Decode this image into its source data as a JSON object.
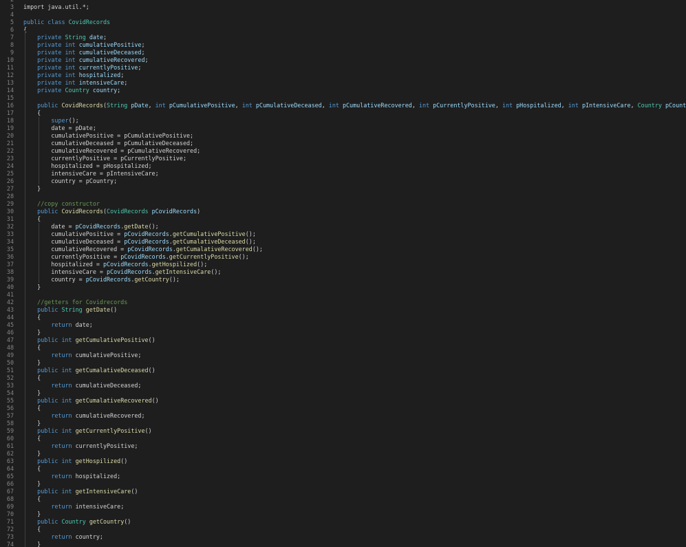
{
  "editor": {
    "language": "java",
    "theme_colors": {
      "background": "#1e1e1e",
      "line_number": "#858585",
      "keyword": "#569cd6",
      "type": "#4ec9b0",
      "function": "#dcdcaa",
      "variable": "#9cdcfe",
      "plain": "#d4d4d4",
      "comment": "#6a9955"
    },
    "lines": [
      {
        "n": "2",
        "tokens": []
      },
      {
        "n": "3",
        "tokens": [
          {
            "t": "import java.util.*;",
            "c": "plain"
          }
        ]
      },
      {
        "n": "4",
        "tokens": []
      },
      {
        "n": "5",
        "tokens": [
          {
            "t": "public class ",
            "c": "kw"
          },
          {
            "t": "CovidRecords",
            "c": "type"
          }
        ]
      },
      {
        "n": "6",
        "tokens": [
          {
            "t": "{",
            "c": "plain"
          }
        ]
      },
      {
        "n": "7",
        "tokens": [
          {
            "t": "    private ",
            "c": "kw"
          },
          {
            "t": "String ",
            "c": "type"
          },
          {
            "t": "date",
            "c": "var"
          },
          {
            "t": ";",
            "c": "plain"
          }
        ]
      },
      {
        "n": "8",
        "tokens": [
          {
            "t": "    private int ",
            "c": "kw"
          },
          {
            "t": "cumulativePositive",
            "c": "var"
          },
          {
            "t": ";",
            "c": "plain"
          }
        ]
      },
      {
        "n": "9",
        "tokens": [
          {
            "t": "    private int ",
            "c": "kw"
          },
          {
            "t": "cumulativeDeceased",
            "c": "var"
          },
          {
            "t": ";",
            "c": "plain"
          }
        ]
      },
      {
        "n": "10",
        "tokens": [
          {
            "t": "    private int ",
            "c": "kw"
          },
          {
            "t": "cumulativeRecovered",
            "c": "var"
          },
          {
            "t": ";",
            "c": "plain"
          }
        ]
      },
      {
        "n": "11",
        "tokens": [
          {
            "t": "    private int ",
            "c": "kw"
          },
          {
            "t": "currentlyPositive",
            "c": "var"
          },
          {
            "t": ";",
            "c": "plain"
          }
        ]
      },
      {
        "n": "12",
        "tokens": [
          {
            "t": "    private int ",
            "c": "kw"
          },
          {
            "t": "hospitalized",
            "c": "var"
          },
          {
            "t": ";",
            "c": "plain"
          }
        ]
      },
      {
        "n": "13",
        "tokens": [
          {
            "t": "    private int ",
            "c": "kw"
          },
          {
            "t": "intensiveCare",
            "c": "var"
          },
          {
            "t": ";",
            "c": "plain"
          }
        ]
      },
      {
        "n": "14",
        "tokens": [
          {
            "t": "    private ",
            "c": "kw"
          },
          {
            "t": "Country ",
            "c": "type"
          },
          {
            "t": "country",
            "c": "var"
          },
          {
            "t": ";",
            "c": "plain"
          }
        ]
      },
      {
        "n": "15",
        "tokens": []
      },
      {
        "n": "16",
        "tokens": [
          {
            "t": "    public ",
            "c": "kw"
          },
          {
            "t": "CovidRecords",
            "c": "fn"
          },
          {
            "t": "(",
            "c": "plain"
          },
          {
            "t": "String ",
            "c": "type"
          },
          {
            "t": "pDate",
            "c": "var"
          },
          {
            "t": ", ",
            "c": "plain"
          },
          {
            "t": "int ",
            "c": "kw"
          },
          {
            "t": "pCumulativePositive",
            "c": "var"
          },
          {
            "t": ", ",
            "c": "plain"
          },
          {
            "t": "int ",
            "c": "kw"
          },
          {
            "t": "pCumulativeDeceased",
            "c": "var"
          },
          {
            "t": ", ",
            "c": "plain"
          },
          {
            "t": "int ",
            "c": "kw"
          },
          {
            "t": "pCumulativeRecovered",
            "c": "var"
          },
          {
            "t": ", ",
            "c": "plain"
          },
          {
            "t": "int ",
            "c": "kw"
          },
          {
            "t": "pCurrentlyPositive",
            "c": "var"
          },
          {
            "t": ", ",
            "c": "plain"
          },
          {
            "t": "int ",
            "c": "kw"
          },
          {
            "t": "pHospitalized",
            "c": "var"
          },
          {
            "t": ", ",
            "c": "plain"
          },
          {
            "t": "int ",
            "c": "kw"
          },
          {
            "t": "pIntensiveCare",
            "c": "var"
          },
          {
            "t": ", ",
            "c": "plain"
          },
          {
            "t": "Country ",
            "c": "type"
          },
          {
            "t": "pCountry",
            "c": "var"
          },
          {
            "t": ")",
            "c": "plain"
          }
        ]
      },
      {
        "n": "17",
        "tokens": [
          {
            "t": "    {",
            "c": "plain"
          }
        ]
      },
      {
        "n": "18",
        "tokens": [
          {
            "t": "        super",
            "c": "kw"
          },
          {
            "t": "();",
            "c": "plain"
          }
        ]
      },
      {
        "n": "19",
        "tokens": [
          {
            "t": "        date = pDate;",
            "c": "plain"
          }
        ]
      },
      {
        "n": "20",
        "tokens": [
          {
            "t": "        cumulativePositive = pCumulativePositive;",
            "c": "plain"
          }
        ]
      },
      {
        "n": "21",
        "tokens": [
          {
            "t": "        cumulativeDeceased = pCumulativeDeceased;",
            "c": "plain"
          }
        ]
      },
      {
        "n": "22",
        "tokens": [
          {
            "t": "        cumulativeRecovered = pCumulativeRecovered;",
            "c": "plain"
          }
        ]
      },
      {
        "n": "23",
        "tokens": [
          {
            "t": "        currentlyPositive = pCurrentlyPositive;",
            "c": "plain"
          }
        ]
      },
      {
        "n": "24",
        "tokens": [
          {
            "t": "        hospitalized = pHospitalized;",
            "c": "plain"
          }
        ]
      },
      {
        "n": "25",
        "tokens": [
          {
            "t": "        intensiveCare = pIntensiveCare;",
            "c": "plain"
          }
        ]
      },
      {
        "n": "26",
        "tokens": [
          {
            "t": "        country = pCountry;",
            "c": "plain"
          }
        ]
      },
      {
        "n": "27",
        "tokens": [
          {
            "t": "    }",
            "c": "plain"
          }
        ]
      },
      {
        "n": "28",
        "tokens": []
      },
      {
        "n": "29",
        "tokens": [
          {
            "t": "    //copy constructor",
            "c": "comment"
          }
        ]
      },
      {
        "n": "30",
        "tokens": [
          {
            "t": "    public ",
            "c": "kw"
          },
          {
            "t": "CovidRecords",
            "c": "fn"
          },
          {
            "t": "(",
            "c": "plain"
          },
          {
            "t": "CovidRecords ",
            "c": "type"
          },
          {
            "t": "pCovidRecords",
            "c": "var"
          },
          {
            "t": ")",
            "c": "plain"
          }
        ]
      },
      {
        "n": "31",
        "tokens": [
          {
            "t": "    {",
            "c": "plain"
          }
        ]
      },
      {
        "n": "32",
        "tokens": [
          {
            "t": "        date = ",
            "c": "plain"
          },
          {
            "t": "pCovidRecords",
            "c": "var"
          },
          {
            "t": ".",
            "c": "plain"
          },
          {
            "t": "getDate",
            "c": "fn"
          },
          {
            "t": "();",
            "c": "plain"
          }
        ]
      },
      {
        "n": "33",
        "tokens": [
          {
            "t": "        cumulativePositive = ",
            "c": "plain"
          },
          {
            "t": "pCovidRecords",
            "c": "var"
          },
          {
            "t": ".",
            "c": "plain"
          },
          {
            "t": "getCumulativePositive",
            "c": "fn"
          },
          {
            "t": "();",
            "c": "plain"
          }
        ]
      },
      {
        "n": "34",
        "tokens": [
          {
            "t": "        cumulativeDeceased = ",
            "c": "plain"
          },
          {
            "t": "pCovidRecords",
            "c": "var"
          },
          {
            "t": ".",
            "c": "plain"
          },
          {
            "t": "getCumalativeDeceased",
            "c": "fn"
          },
          {
            "t": "();",
            "c": "plain"
          }
        ]
      },
      {
        "n": "35",
        "tokens": [
          {
            "t": "        cumulativeRecovered = ",
            "c": "plain"
          },
          {
            "t": "pCovidRecords",
            "c": "var"
          },
          {
            "t": ".",
            "c": "plain"
          },
          {
            "t": "getCumalativeRecovered",
            "c": "fn"
          },
          {
            "t": "();",
            "c": "plain"
          }
        ]
      },
      {
        "n": "36",
        "tokens": [
          {
            "t": "        currentlyPositive = ",
            "c": "plain"
          },
          {
            "t": "pCovidRecords",
            "c": "var"
          },
          {
            "t": ".",
            "c": "plain"
          },
          {
            "t": "getCurrentlyPositive",
            "c": "fn"
          },
          {
            "t": "();",
            "c": "plain"
          }
        ]
      },
      {
        "n": "37",
        "tokens": [
          {
            "t": "        hospitalized = ",
            "c": "plain"
          },
          {
            "t": "pCovidRecords",
            "c": "var"
          },
          {
            "t": ".",
            "c": "plain"
          },
          {
            "t": "getHospilized",
            "c": "fn"
          },
          {
            "t": "();",
            "c": "plain"
          }
        ]
      },
      {
        "n": "38",
        "tokens": [
          {
            "t": "        intensiveCare = ",
            "c": "plain"
          },
          {
            "t": "pCovidRecords",
            "c": "var"
          },
          {
            "t": ".",
            "c": "plain"
          },
          {
            "t": "getIntensiveCare",
            "c": "fn"
          },
          {
            "t": "();",
            "c": "plain"
          }
        ]
      },
      {
        "n": "39",
        "tokens": [
          {
            "t": "        country = ",
            "c": "plain"
          },
          {
            "t": "pCovidRecords",
            "c": "var"
          },
          {
            "t": ".",
            "c": "plain"
          },
          {
            "t": "getCountry",
            "c": "fn"
          },
          {
            "t": "();",
            "c": "plain"
          }
        ]
      },
      {
        "n": "40",
        "tokens": [
          {
            "t": "    }",
            "c": "plain"
          }
        ]
      },
      {
        "n": "41",
        "tokens": []
      },
      {
        "n": "42",
        "tokens": [
          {
            "t": "    //getters for Covidrecords",
            "c": "comment"
          }
        ]
      },
      {
        "n": "43",
        "tokens": [
          {
            "t": "    public ",
            "c": "kw"
          },
          {
            "t": "String ",
            "c": "type"
          },
          {
            "t": "getDate",
            "c": "fn"
          },
          {
            "t": "()",
            "c": "plain"
          }
        ]
      },
      {
        "n": "44",
        "tokens": [
          {
            "t": "    {",
            "c": "plain"
          }
        ]
      },
      {
        "n": "45",
        "tokens": [
          {
            "t": "        return ",
            "c": "kw"
          },
          {
            "t": "date;",
            "c": "plain"
          }
        ]
      },
      {
        "n": "46",
        "tokens": [
          {
            "t": "    }",
            "c": "plain"
          }
        ]
      },
      {
        "n": "47",
        "tokens": [
          {
            "t": "    public int ",
            "c": "kw"
          },
          {
            "t": "getCumulativePositive",
            "c": "fn"
          },
          {
            "t": "()",
            "c": "plain"
          }
        ]
      },
      {
        "n": "48",
        "tokens": [
          {
            "t": "    {",
            "c": "plain"
          }
        ]
      },
      {
        "n": "49",
        "tokens": [
          {
            "t": "        return ",
            "c": "kw"
          },
          {
            "t": "cumulativePositive;",
            "c": "plain"
          }
        ]
      },
      {
        "n": "50",
        "tokens": [
          {
            "t": "    }",
            "c": "plain"
          }
        ]
      },
      {
        "n": "51",
        "tokens": [
          {
            "t": "    public int ",
            "c": "kw"
          },
          {
            "t": "getCumalativeDeceased",
            "c": "fn"
          },
          {
            "t": "()",
            "c": "plain"
          }
        ]
      },
      {
        "n": "52",
        "tokens": [
          {
            "t": "    {",
            "c": "plain"
          }
        ]
      },
      {
        "n": "53",
        "tokens": [
          {
            "t": "        return ",
            "c": "kw"
          },
          {
            "t": "cumulativeDeceased;",
            "c": "plain"
          }
        ]
      },
      {
        "n": "54",
        "tokens": [
          {
            "t": "    }",
            "c": "plain"
          }
        ]
      },
      {
        "n": "55",
        "tokens": [
          {
            "t": "    public int ",
            "c": "kw"
          },
          {
            "t": "getCumalativeRecovered",
            "c": "fn"
          },
          {
            "t": "()",
            "c": "plain"
          }
        ]
      },
      {
        "n": "56",
        "tokens": [
          {
            "t": "    {",
            "c": "plain"
          }
        ]
      },
      {
        "n": "57",
        "tokens": [
          {
            "t": "        return ",
            "c": "kw"
          },
          {
            "t": "cumulativeRecovered;",
            "c": "plain"
          }
        ]
      },
      {
        "n": "58",
        "tokens": [
          {
            "t": "    }",
            "c": "plain"
          }
        ]
      },
      {
        "n": "59",
        "tokens": [
          {
            "t": "    public int ",
            "c": "kw"
          },
          {
            "t": "getCurrentlyPositive",
            "c": "fn"
          },
          {
            "t": "()",
            "c": "plain"
          }
        ]
      },
      {
        "n": "60",
        "tokens": [
          {
            "t": "    {",
            "c": "plain"
          }
        ]
      },
      {
        "n": "61",
        "tokens": [
          {
            "t": "        return ",
            "c": "kw"
          },
          {
            "t": "currentlyPositive;",
            "c": "plain"
          }
        ]
      },
      {
        "n": "62",
        "tokens": [
          {
            "t": "    }",
            "c": "plain"
          }
        ]
      },
      {
        "n": "63",
        "tokens": [
          {
            "t": "    public int ",
            "c": "kw"
          },
          {
            "t": "getHospilized",
            "c": "fn"
          },
          {
            "t": "()",
            "c": "plain"
          }
        ]
      },
      {
        "n": "64",
        "tokens": [
          {
            "t": "    {",
            "c": "plain"
          }
        ]
      },
      {
        "n": "65",
        "tokens": [
          {
            "t": "        return ",
            "c": "kw"
          },
          {
            "t": "hospitalized;",
            "c": "plain"
          }
        ]
      },
      {
        "n": "66",
        "tokens": [
          {
            "t": "    }",
            "c": "plain"
          }
        ]
      },
      {
        "n": "67",
        "tokens": [
          {
            "t": "    public int ",
            "c": "kw"
          },
          {
            "t": "getIntensiveCare",
            "c": "fn"
          },
          {
            "t": "()",
            "c": "plain"
          }
        ]
      },
      {
        "n": "68",
        "tokens": [
          {
            "t": "    {",
            "c": "plain"
          }
        ]
      },
      {
        "n": "69",
        "tokens": [
          {
            "t": "        return ",
            "c": "kw"
          },
          {
            "t": "intensiveCare;",
            "c": "plain"
          }
        ]
      },
      {
        "n": "70",
        "tokens": [
          {
            "t": "    }",
            "c": "plain"
          }
        ]
      },
      {
        "n": "71",
        "tokens": [
          {
            "t": "    public ",
            "c": "kw"
          },
          {
            "t": "Country ",
            "c": "type"
          },
          {
            "t": "getCountry",
            "c": "fn"
          },
          {
            "t": "()",
            "c": "plain"
          }
        ]
      },
      {
        "n": "72",
        "tokens": [
          {
            "t": "    {",
            "c": "plain"
          }
        ]
      },
      {
        "n": "73",
        "tokens": [
          {
            "t": "        return ",
            "c": "kw"
          },
          {
            "t": "country;",
            "c": "plain"
          }
        ]
      },
      {
        "n": "74",
        "tokens": [
          {
            "t": "    }",
            "c": "plain"
          }
        ]
      }
    ]
  }
}
